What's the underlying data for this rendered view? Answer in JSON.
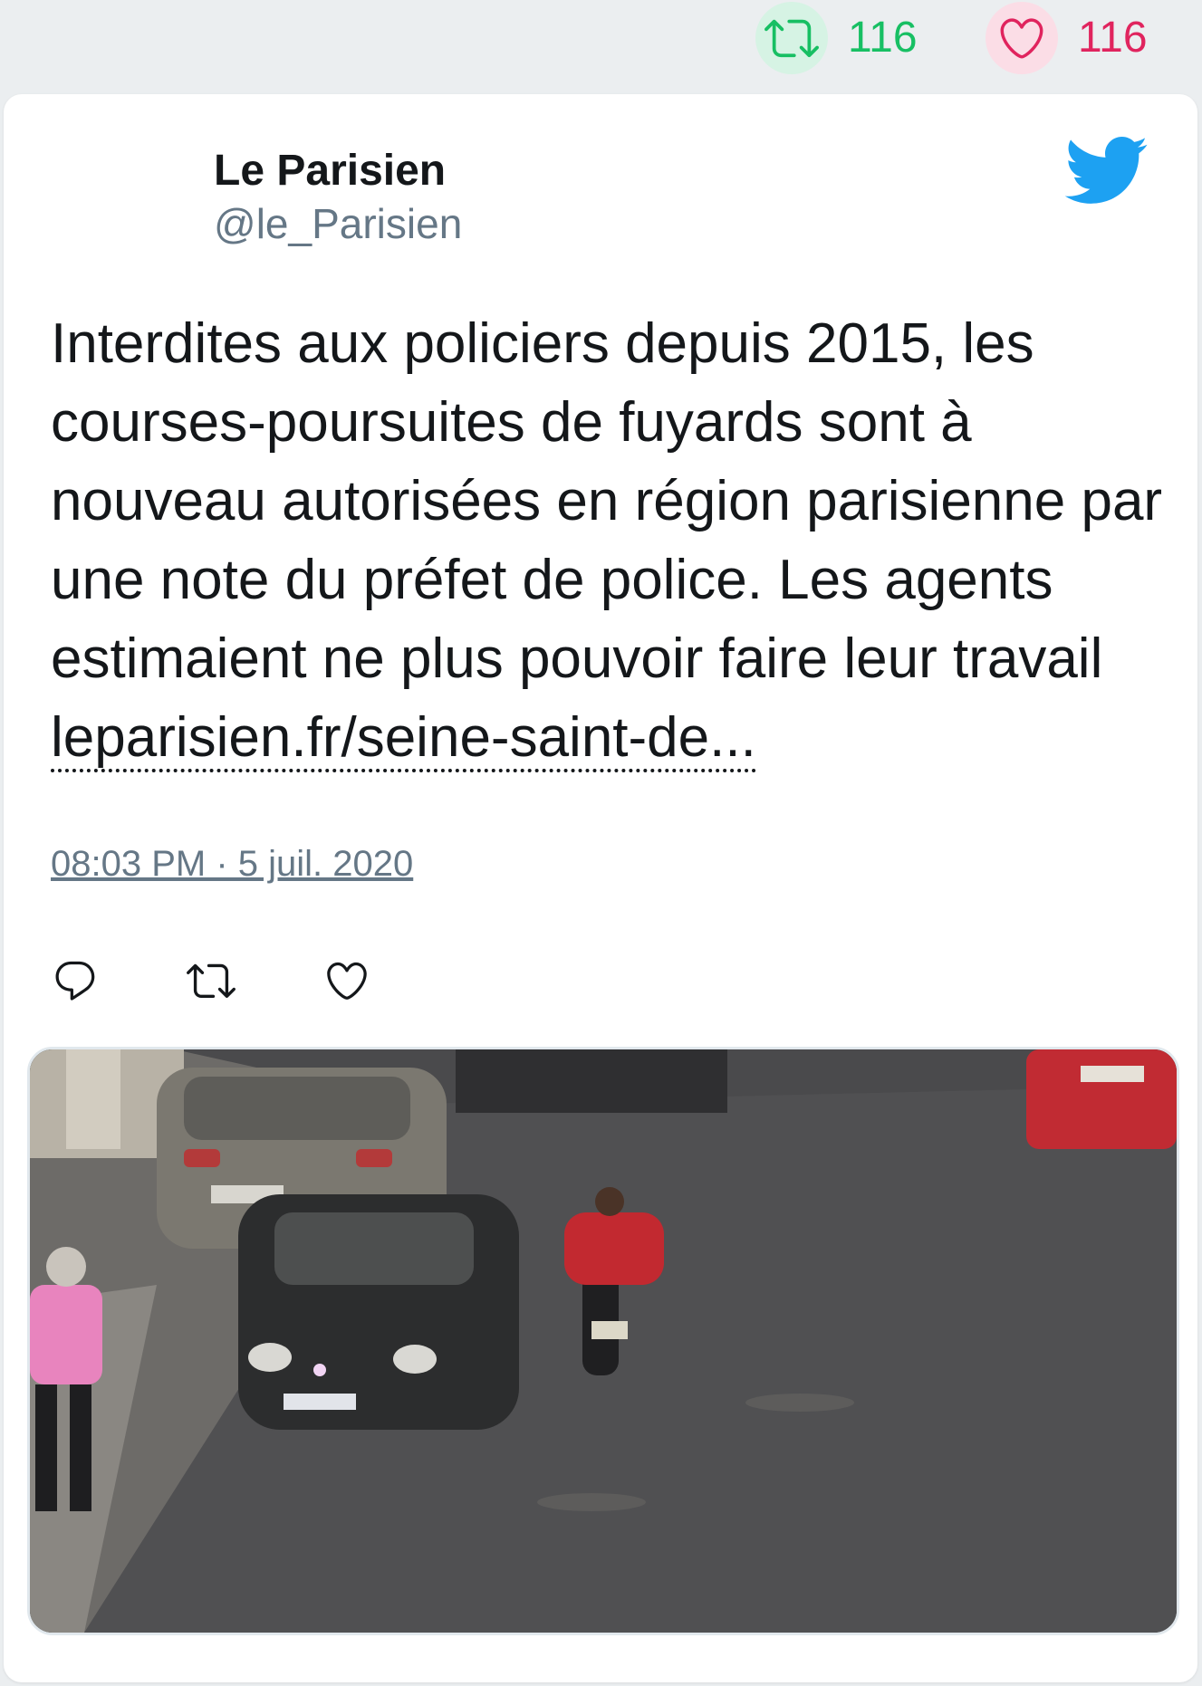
{
  "stats": {
    "retweets": "116",
    "likes": "116"
  },
  "author": {
    "name": "Le Parisien",
    "handle": "@le_Parisien"
  },
  "tweet": {
    "text": "Interdites aux policiers depuis 2015, les courses-poursuites de fuyards sont à nouveau autorisées en région parisienne par une note du préfet de police. Les agents estimaient ne plus pouvoir faire leur travail ",
    "link": "leparisien.fr/seine-saint-de...",
    "timestamp": "08:03 PM · 5 juil. 2020"
  },
  "icons": {
    "brand": "twitter-bird-icon",
    "retweet": "retweet-icon",
    "like": "heart-icon",
    "reply": "reply-icon"
  },
  "colors": {
    "retweet_green": "#17bf63",
    "like_red": "#e0245e",
    "twitter_blue": "#1da1f2",
    "secondary_text": "#657786"
  }
}
